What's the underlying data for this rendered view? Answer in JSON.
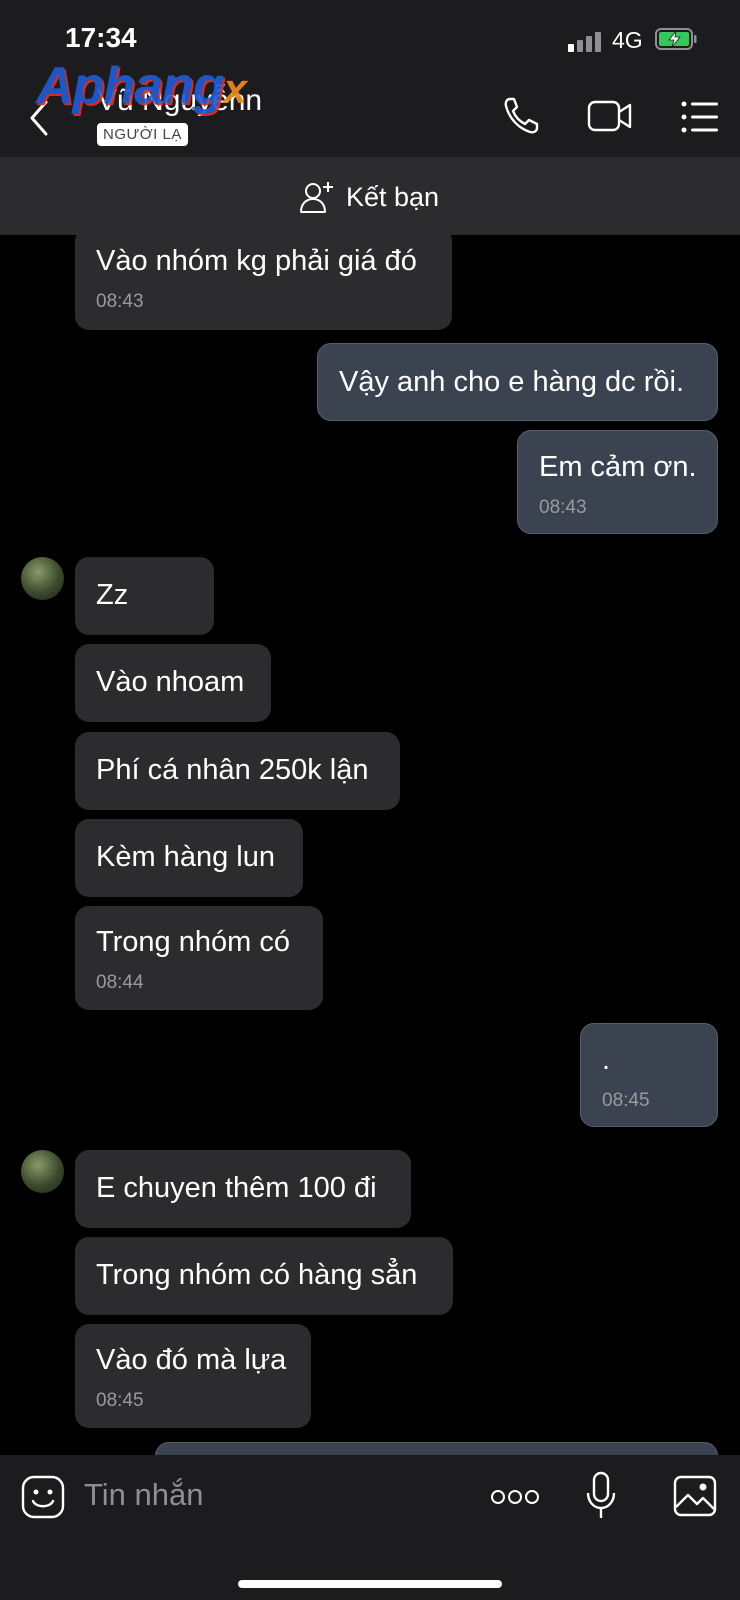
{
  "status_bar": {
    "time": "17:34",
    "network": "4G"
  },
  "header": {
    "contact_name": "Vũ Nguyễnn",
    "stranger_badge": "NGƯỜI LẠ",
    "watermark_main": "Aphang",
    "watermark_x": "x",
    "icons": [
      "back-icon",
      "phone-icon",
      "video-icon",
      "menu-icon"
    ]
  },
  "add_friend": {
    "label": "Kết bạn"
  },
  "messages": [
    {
      "dir": "in",
      "text": "Vào nhóm kg phải giá đó",
      "time": "08:43"
    },
    {
      "dir": "out",
      "text": "Vậy anh cho e hàng dc rồi.",
      "time": ""
    },
    {
      "dir": "out",
      "text": "Em cảm ơn.",
      "time": "08:43"
    },
    {
      "dir": "in",
      "text": "Zz",
      "time": ""
    },
    {
      "dir": "in",
      "text": "Vào nhoam",
      "time": ""
    },
    {
      "dir": "in",
      "text": "Phí cá nhân 250k lận",
      "time": ""
    },
    {
      "dir": "in",
      "text": "Kèm hàng lun",
      "time": ""
    },
    {
      "dir": "in",
      "text": "Trong nhóm có",
      "time": "08:44"
    },
    {
      "dir": "out",
      "text": ".",
      "time": "08:45"
    },
    {
      "dir": "in",
      "text": "E chuyen thêm 100 đi",
      "time": ""
    },
    {
      "dir": "in",
      "text": "Trong nhóm có hàng sẳn",
      "time": ""
    },
    {
      "dir": "in",
      "text": "Vào đó mà lựa",
      "time": "08:45"
    }
  ],
  "input": {
    "placeholder": "Tin nhắn"
  },
  "colors": {
    "incoming": "#2c2c2e",
    "outgoing": "#3b4350",
    "header": "#1c1c1e"
  }
}
